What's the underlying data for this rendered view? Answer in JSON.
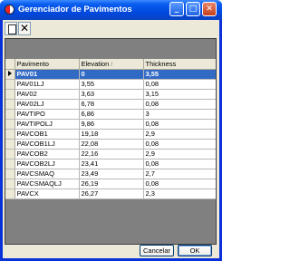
{
  "window": {
    "title": "Gerenciador de Pavimentos",
    "controls": {
      "minimize": "_",
      "maximize": "□",
      "close": "✕"
    }
  },
  "toolbar": {
    "new_icon": "new-document-icon",
    "delete_icon": "delete-x-icon",
    "delete_glyph": "✕"
  },
  "grid": {
    "columns": [
      "Pavimento",
      "Elevation",
      "Thickness"
    ],
    "sort_indicator": "/",
    "rows": [
      [
        "PAV01",
        "0",
        "3,55"
      ],
      [
        "PAV01LJ",
        "3,55",
        "0,08"
      ],
      [
        "PAV02",
        "3,63",
        "3,15"
      ],
      [
        "PAV02LJ",
        "6,78",
        "0,08"
      ],
      [
        "PAVTIPO",
        "6,86",
        "3"
      ],
      [
        "PAVTIPOLJ",
        "9,86",
        "0,08"
      ],
      [
        "PAVCOB1",
        "19,18",
        "2,9"
      ],
      [
        "PAVCOB1LJ",
        "22,08",
        "0,08"
      ],
      [
        "PAVCOB2",
        "22,16",
        "2,9"
      ],
      [
        "PAVCOB2LJ",
        "23,41",
        "0,08"
      ],
      [
        "PAVCSMAQ",
        "23,49",
        "2,7"
      ],
      [
        "PAVCSMAQLJ",
        "26,19",
        "0,08"
      ],
      [
        "PAVCX",
        "26,27",
        "2,3"
      ]
    ],
    "selected_index": 0
  },
  "buttons": {
    "cancel": "Cancelar",
    "ok": "OK"
  },
  "colors": {
    "titlebar": "#0a5ef0",
    "selection": "#316ac5",
    "dialog_bg": "#ece9d8"
  }
}
